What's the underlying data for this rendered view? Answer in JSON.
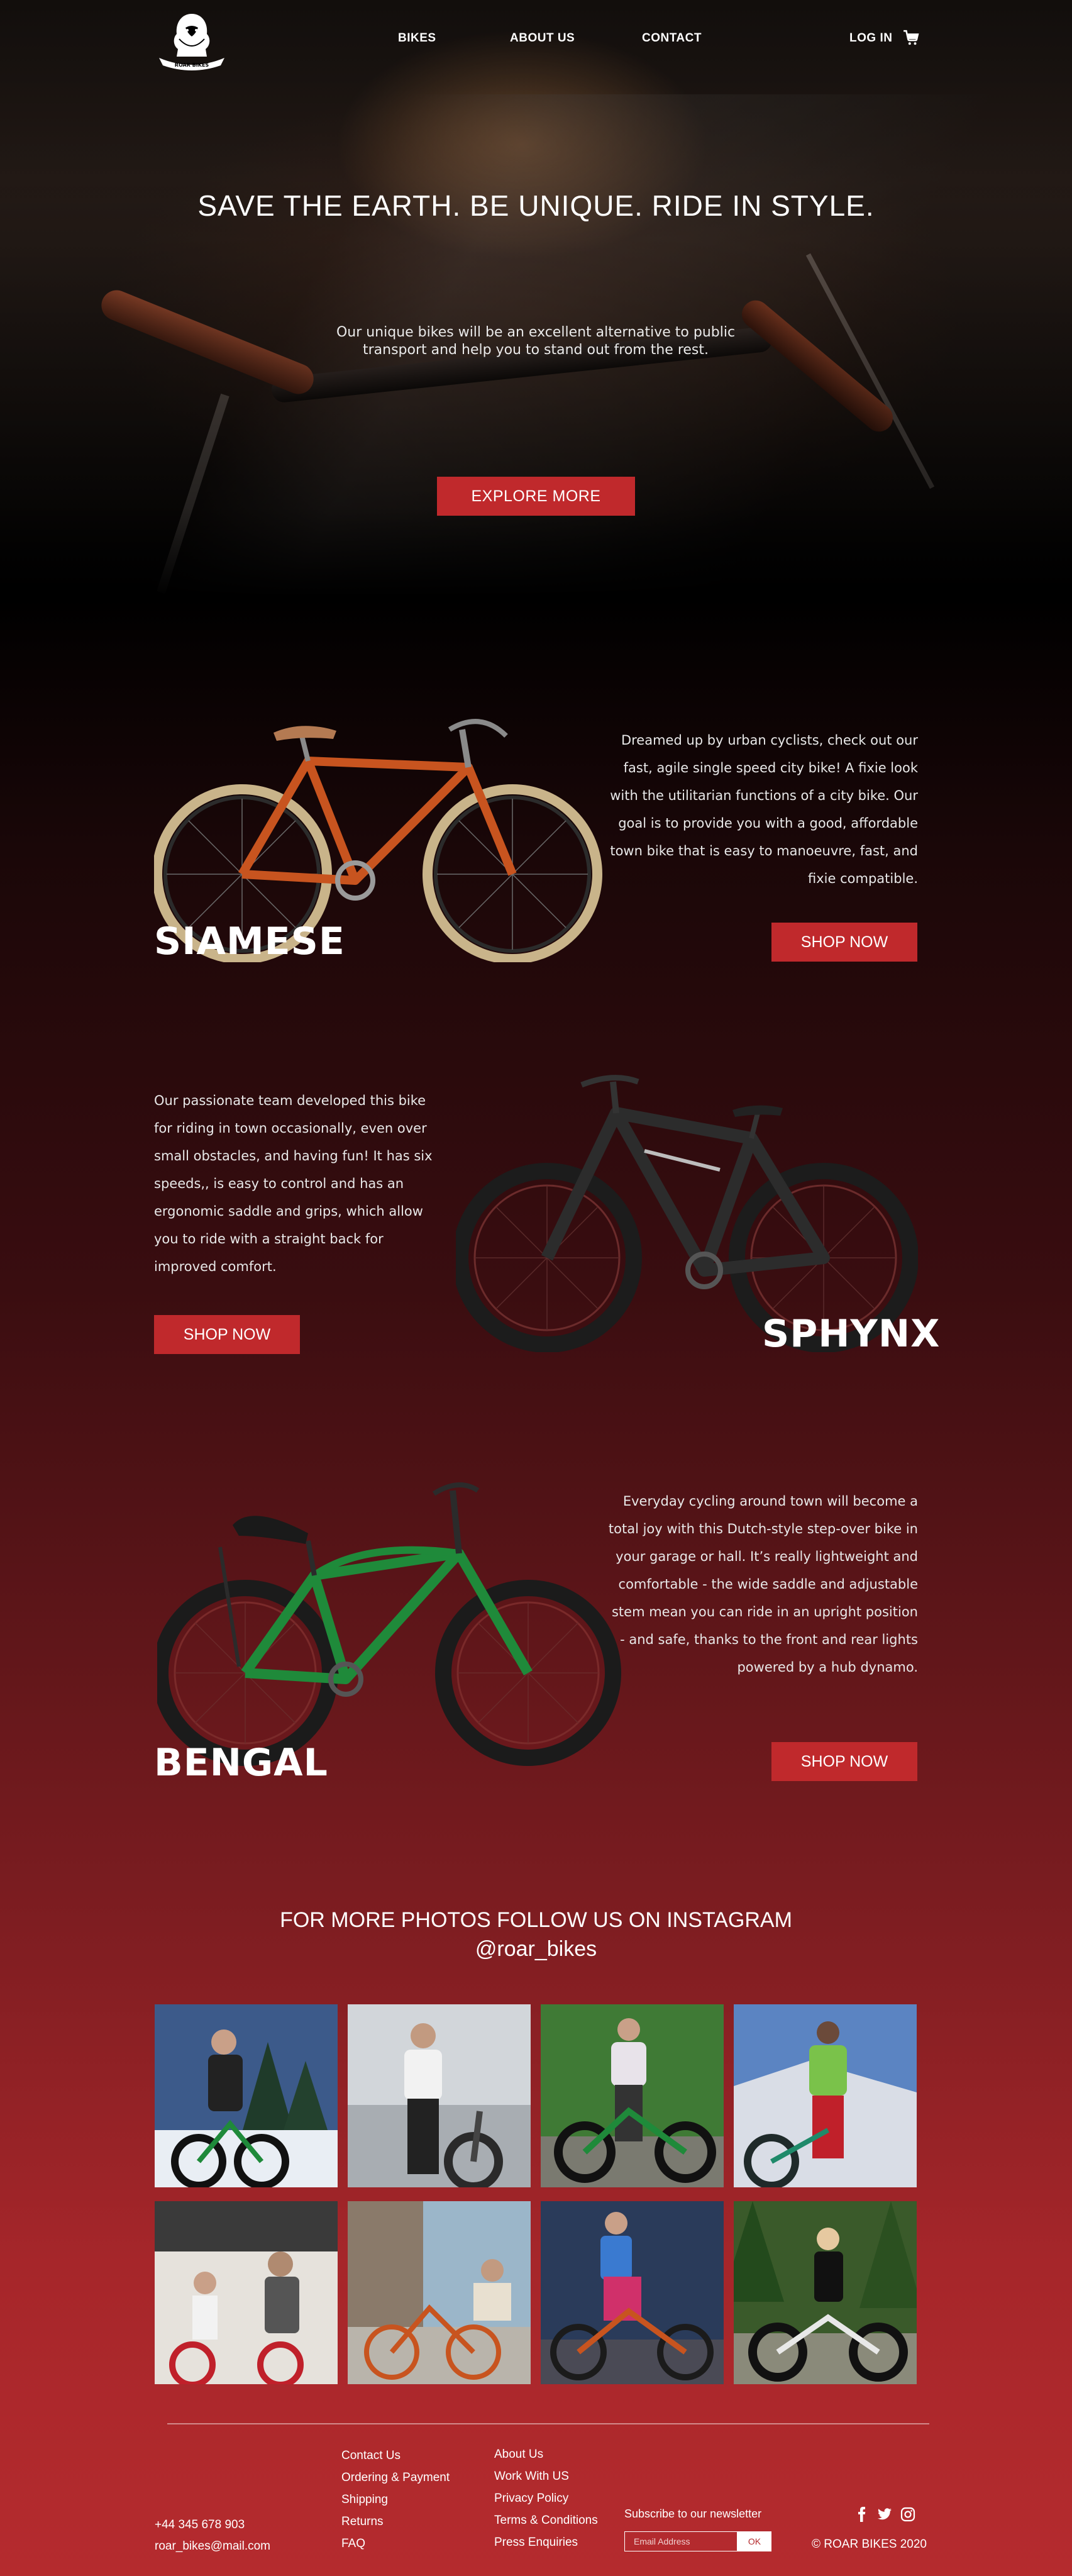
{
  "brand": {
    "logo_alt": "ROAR BIKES"
  },
  "nav": {
    "items": [
      {
        "label": "BIKES"
      },
      {
        "label": "ABOUT US"
      },
      {
        "label": "CONTACT"
      }
    ],
    "login_label": "LOG IN",
    "cart_icon": "cart-icon"
  },
  "hero": {
    "title": "SAVE THE EARTH. BE UNIQUE. RIDE IN STYLE.",
    "subtitle": "Our unique bikes will be an excellent alternative to public transport and help you to stand out from the rest.",
    "button_label": "EXPLORE MORE"
  },
  "products": [
    {
      "name": "SIAMESE",
      "description": "Dreamed up by urban cyclists, check out our fast, agile single speed city bike! A fixie look with the utilitarian functions of a city bike. Our goal is to provide you with a good, affordable town bike that is easy to manoeuvre, fast, and fixie compatible.",
      "button_label": "SHOP NOW"
    },
    {
      "name": "SPHYNX",
      "description": "Our passionate team developed this bike for riding in town occasionally, even over small obstacles, and having fun! It has six speeds,, is easy to control and has an ergonomic saddle and grips, which allow you to ride with a straight back for improved comfort.",
      "button_label": "SHOP NOW"
    },
    {
      "name": "BENGAL",
      "description": "Everyday cycling around town will become a total joy with this Dutch-style step-over bike in your garage or hall. It’s really lightweight and comfortable - the wide saddle and adjustable stem mean you can ride in an upright position - and safe, thanks to the front and rear lights powered by a hub dynamo.",
      "button_label": "SHOP NOW"
    }
  ],
  "instagram": {
    "title": "FOR MORE PHOTOS FOLLOW US ON INSTAGRAM",
    "handle": "@roar_bikes"
  },
  "footer": {
    "col1": [
      "Contact Us",
      "Ordering & Payment",
      "Shipping",
      "Returns",
      "FAQ"
    ],
    "col2": [
      "About Us",
      "Work With US",
      "Privacy Policy",
      "Terms & Conditions",
      "Press Enquiries"
    ],
    "phone": "+44 345 678 903",
    "email": "roar_bikes@mail.com",
    "newsletter_label": "Subscribe to our newsletter",
    "newsletter_placeholder": "Email Address",
    "newsletter_button": "OK",
    "social_icons": [
      "facebook-icon",
      "twitter-icon",
      "instagram-icon"
    ],
    "copyright": "© ROAR BIKES 2020"
  },
  "colors": {
    "accent": "#c0292c",
    "background_top": "#000000",
    "background_bottom": "#b52b2e",
    "siamese_frame": "#c8541f",
    "sphynx_frame": "#2a2a2a",
    "bengal_frame": "#1f8a3a"
  }
}
